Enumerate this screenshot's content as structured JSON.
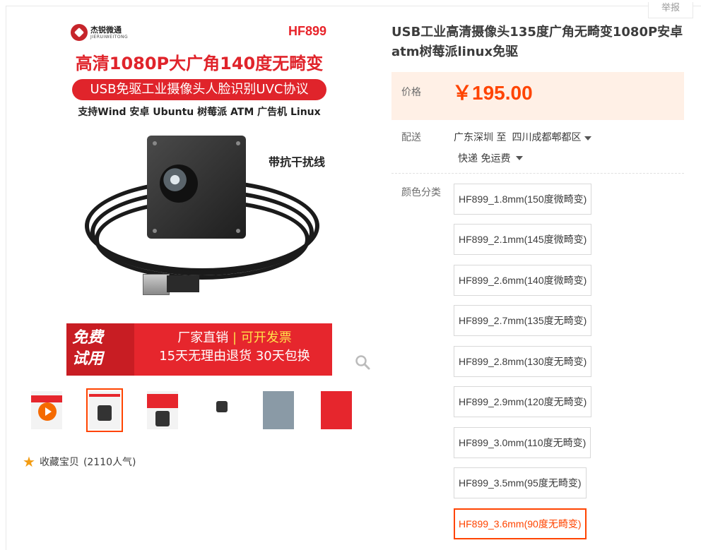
{
  "header": {
    "report_label": "举报"
  },
  "gallery": {
    "brand_name": "杰锐微通",
    "brand_sub": "JIERUIWEITONG",
    "model": "HF899",
    "headline": "高清1080P大广角140度无畸变",
    "pill": "USB免驱工业摄像头人脸识别UVC协议",
    "support": "支持Wind 安卓 Ubuntu 树莓派 ATM 广告机 Linux",
    "cable_label": "带抗干扰线",
    "promo_left_1": "免费",
    "promo_left_2": "试用",
    "promo_right_1a": "厂家直销",
    "promo_right_sep": "|",
    "promo_right_1b": "可开发票",
    "promo_right_2": "15天无理由退货 30天包换",
    "zoom_icon": "magnifier-icon",
    "favorite": {
      "label": "收藏宝贝",
      "count": "(2110人气)",
      "icon": "star-icon"
    }
  },
  "product": {
    "title": "USB工业高清摄像头135度广角无畸变1080P安卓atm树莓派linux免驱",
    "price_label": "价格",
    "price_currency": "￥",
    "price_value": "195.00",
    "shipping_label": "配送",
    "ship_from": "广东深圳 至",
    "ship_to": "四川成都郫都区",
    "ship_method": "快递 免运费",
    "color_label": "颜色分类",
    "options": [
      "HF899_1.8mm(150度微畸变)",
      "HF899_2.1mm(145度微畸变)",
      "HF899_2.6mm(140度微畸变)",
      "HF899_2.7mm(135度无畸变)",
      "HF899_2.8mm(130度无畸变)",
      "HF899_2.9mm(120度无畸变)",
      "HF899_3.0mm(110度无畸变)",
      "HF899_3.5mm(95度无畸变)",
      "HF899_3.6mm(90度无畸变)"
    ],
    "selected_option_index": 8
  },
  "colors": {
    "accent": "#ff4400",
    "price_bg": "#fff0e6",
    "promo_red": "#e6262d"
  }
}
